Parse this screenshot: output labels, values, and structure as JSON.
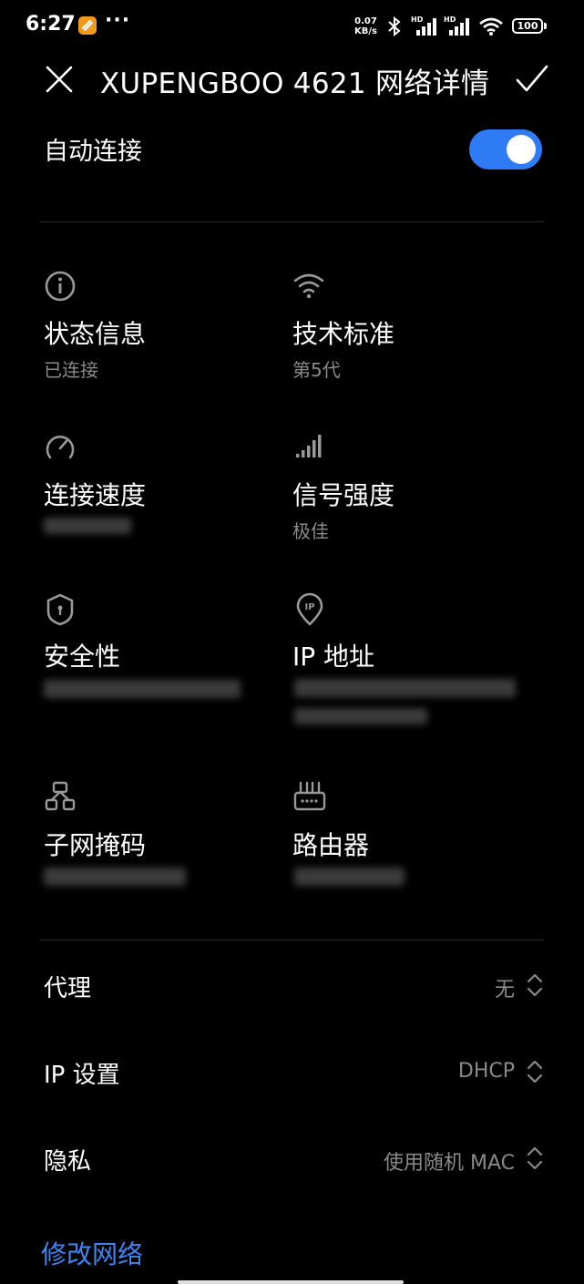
{
  "status_bar": {
    "time": "6:27",
    "more": "···",
    "net_speed_value": "0.07",
    "net_speed_unit": "KB/s",
    "signal1_tag": "HD",
    "signal2_tag": "HD",
    "battery": "100"
  },
  "header": {
    "title": "XUPENGBOO 4621 网络详情"
  },
  "auto_connect": {
    "label": "自动连接",
    "enabled": true
  },
  "info": {
    "status": {
      "title": "状态信息",
      "value": "已连接",
      "icon": "info-icon"
    },
    "standard": {
      "title": "技术标准",
      "value": "第5代",
      "icon": "wifi-icon"
    },
    "speed": {
      "title": "连接速度",
      "icon": "speedometer-icon"
    },
    "signal": {
      "title": "信号强度",
      "value": "极佳",
      "icon": "signal-bars-icon"
    },
    "security": {
      "title": "安全性",
      "icon": "shield-icon"
    },
    "ip": {
      "title": "IP 地址",
      "icon": "ip-location-icon"
    },
    "subnet": {
      "title": "子网掩码",
      "icon": "network-tree-icon"
    },
    "router": {
      "title": "路由器",
      "icon": "router-icon"
    }
  },
  "settings": [
    {
      "label": "代理",
      "value": "无"
    },
    {
      "label": "IP 设置",
      "value": "DHCP"
    },
    {
      "label": "隐私",
      "value": "使用随机 MAC"
    }
  ],
  "modify_link": "修改网络",
  "colors": {
    "accent": "#2f7bf5",
    "link": "#3d87f5",
    "secondary_text": "#8a8a8a"
  }
}
